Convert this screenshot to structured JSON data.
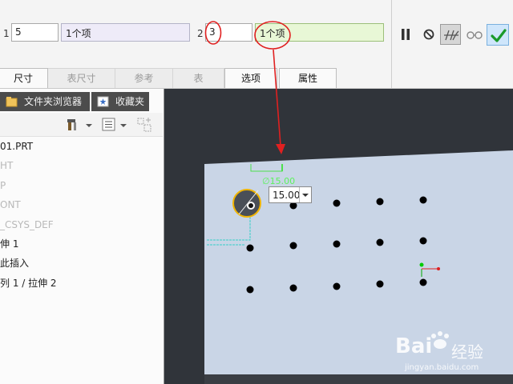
{
  "dashboard": {
    "field1": {
      "index": "1",
      "value": "5",
      "collection": "1个项"
    },
    "field2": {
      "index": "2",
      "value": "3",
      "collection": "1个项"
    },
    "tools": [
      "pause-icon",
      "stop-icon",
      "preview-icon",
      "glasses-icon",
      "confirm-check-icon"
    ]
  },
  "tabs": [
    {
      "label": "尺寸",
      "active": true
    },
    {
      "label": "表尺寸",
      "active": false
    },
    {
      "label": "参考",
      "active": false
    },
    {
      "label": "表",
      "active": false
    },
    {
      "label": "选项",
      "active": true
    },
    {
      "label": "属性",
      "active": true
    }
  ],
  "panel": {
    "tab_browser": "文件夹浏览器",
    "tab_favorites": "收藏夹"
  },
  "tree": [
    {
      "label": "01.PRT",
      "dim": false
    },
    {
      "label": "HT",
      "dim": true
    },
    {
      "label": "P",
      "dim": true
    },
    {
      "label": "ONT",
      "dim": true
    },
    {
      "label": "_CSYS_DEF",
      "dim": true
    },
    {
      "label": "伸 1",
      "dim": false
    },
    {
      "label": "此插入",
      "dim": false
    },
    {
      "label": "列 1 / 拉伸 2",
      "dim": false
    }
  ],
  "sketch": {
    "dim_label": "∅15.00",
    "dim_value": "15.00"
  },
  "watermark": {
    "main": "Bai",
    "cn": "经验",
    "sub": "jingyan.baidu.com"
  },
  "colors": {
    "accent_red": "#e02020",
    "dim_green": "#5df25d",
    "part_face": "#c9d5e6",
    "canvas_bg": "#30343a"
  }
}
